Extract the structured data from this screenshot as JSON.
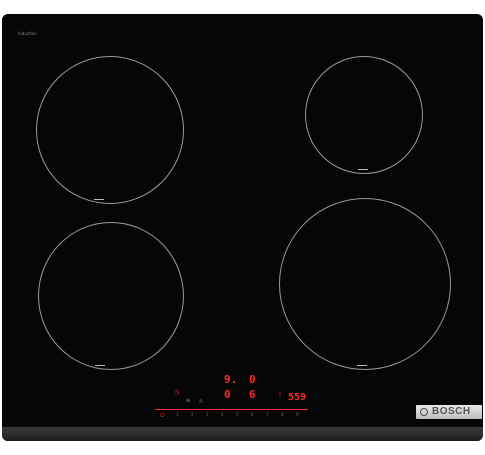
{
  "brand": {
    "name": "BOSCH"
  },
  "labels": {
    "top_left_line1": "Induction",
    "top_left_line2": "",
    "top_right_line1": "",
    "top_right_line2": ""
  },
  "control_panel": {
    "timer_display": "9.",
    "timer_display_right": "0",
    "power_display_left": "0",
    "power_display_right": "6",
    "power_levels_display": "559",
    "power_numbers": [
      "1",
      "2",
      "3",
      "4",
      "5",
      "6",
      "7",
      "8",
      "9"
    ]
  }
}
